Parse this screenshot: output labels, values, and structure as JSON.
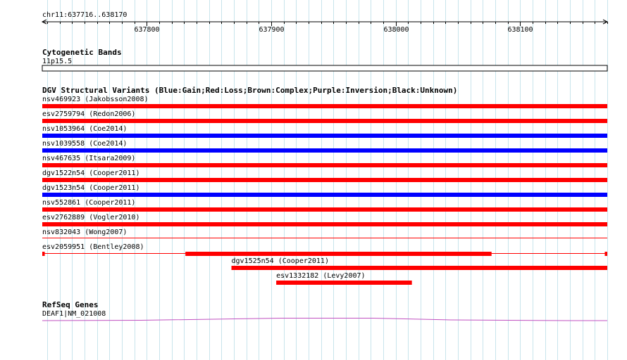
{
  "ruler": {
    "position_label": "chr11:637716..638170",
    "start": 637716,
    "end": 638170,
    "ticks": [
      {
        "value": 637800,
        "label": "637800"
      },
      {
        "value": 637900,
        "label": "637900"
      },
      {
        "value": 638000,
        "label": "638000"
      },
      {
        "value": 638100,
        "label": "638100"
      }
    ]
  },
  "cytoband_track": {
    "title": "Cytogenetic Bands",
    "band": "11p15.5"
  },
  "dgv_track": {
    "title": "DGV Structural Variants (Blue:Gain;Red:Loss;Brown:Complex;Purple:Inversion;Black:Unknown)",
    "colors": {
      "gain": "#0000ff",
      "loss": "#ff0000",
      "complex": "#8b4513",
      "inversion": "#800080",
      "unknown": "#000000"
    },
    "features": [
      {
        "label": "nsv469923 (Jakobsson2008)",
        "type": "loss",
        "start": 637716,
        "end": 638170
      },
      {
        "label": "esv2759794 (Redon2006)",
        "type": "loss",
        "start": 637716,
        "end": 638170
      },
      {
        "label": "nsv1053964 (Coe2014)",
        "type": "gain",
        "start": 637716,
        "end": 638170
      },
      {
        "label": "nsv1039558 (Coe2014)",
        "type": "gain",
        "start": 637716,
        "end": 638170
      },
      {
        "label": "nsv467635 (Itsara2009)",
        "type": "loss",
        "start": 637716,
        "end": 638170
      },
      {
        "label": "dgv1522n54 (Cooper2011)",
        "type": "loss",
        "start": 637716,
        "end": 638170
      },
      {
        "label": "dgv1523n54 (Cooper2011)",
        "type": "gain",
        "start": 637716,
        "end": 638170
      },
      {
        "label": "nsv552861 (Cooper2011)",
        "type": "loss",
        "start": 637716,
        "end": 638170
      },
      {
        "label": "esv2762889 (Vogler2010)",
        "type": "loss",
        "start": 637716,
        "end": 638170
      },
      {
        "label": "nsv832043 (Wong2007)",
        "type": "none",
        "start": 637716,
        "end": 638170
      },
      {
        "label": "esv2059951 (Bentley2008)",
        "type": "loss",
        "start": 637716,
        "end": 638170,
        "blocks": [
          [
            637716,
            637718
          ],
          [
            637831,
            638077
          ],
          [
            638168,
            638170
          ]
        ]
      },
      {
        "label": "dgv1525n54 (Cooper2011)",
        "type": "loss",
        "start": 637868,
        "end": 638170
      },
      {
        "label": "esv1332182 (Levy2007)",
        "type": "loss",
        "start": 637904,
        "end": 638013
      }
    ]
  },
  "refseq_track": {
    "title": "RefSeq Genes",
    "gene_label": "DEAF1|NM_021008",
    "color": "#c050c0"
  }
}
